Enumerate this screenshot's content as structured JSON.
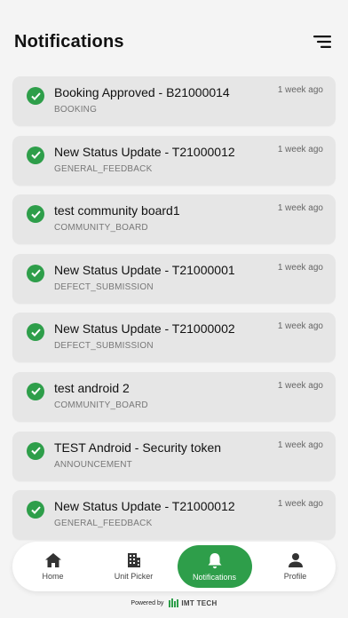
{
  "header": {
    "title": "Notifications"
  },
  "notifications": [
    {
      "title": "Booking Approved - B21000014",
      "category": "BOOKING",
      "time": "1 week ago"
    },
    {
      "title": "New Status Update - T21000012",
      "category": "GENERAL_FEEDBACK",
      "time": "1 week ago"
    },
    {
      "title": "test community board1",
      "category": "COMMUNITY_BOARD",
      "time": "1 week ago"
    },
    {
      "title": "New Status Update - T21000001",
      "category": "DEFECT_SUBMISSION",
      "time": "1 week ago"
    },
    {
      "title": "New Status Update - T21000002",
      "category": "DEFECT_SUBMISSION",
      "time": "1 week ago"
    },
    {
      "title": "test android 2",
      "category": "COMMUNITY_BOARD",
      "time": "1 week ago"
    },
    {
      "title": "TEST Android - Security token",
      "category": "ANNOUNCEMENT",
      "time": "1 week ago"
    },
    {
      "title": "New Status Update - T21000012",
      "category": "GENERAL_FEEDBACK",
      "time": "1 week ago"
    }
  ],
  "nav": {
    "items": [
      {
        "label": "Home",
        "icon": "home-icon"
      },
      {
        "label": "Unit Picker",
        "icon": "building-icon"
      },
      {
        "label": "Notifications",
        "icon": "bell-icon"
      },
      {
        "label": "Profile",
        "icon": "person-icon"
      }
    ],
    "active": "Notifications"
  },
  "footer": {
    "powered_by": "Powered by",
    "brand": "IMT TECH"
  },
  "colors": {
    "accent": "#2e9e4a",
    "card": "#e6e6e6",
    "background": "#f4f4f4"
  }
}
